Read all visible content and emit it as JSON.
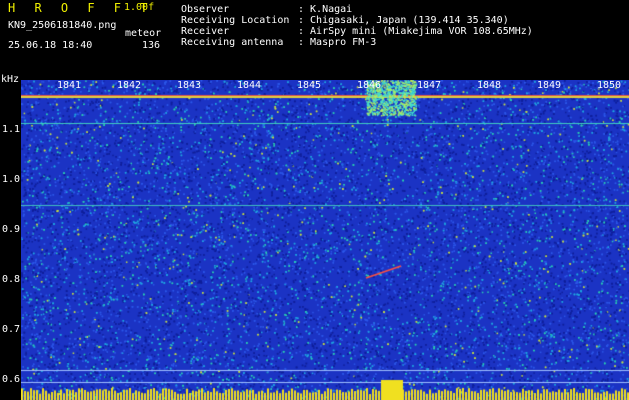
{
  "header": {
    "title": "H R O F F T",
    "version": "1.00f",
    "file": "KN9_2506181840.png",
    "mode": "meteor",
    "datetime": "25.06.18 18:40",
    "count": "136"
  },
  "meta": [
    {
      "label": "Observer",
      "value": ": K.Nagai"
    },
    {
      "label": "Receiving Location",
      "value": ": Chigasaki, Japan (139.414 35.340)"
    },
    {
      "label": "Receiver",
      "value": ": AirSpy mini (Miakejima VOR 108.65MHz)"
    },
    {
      "label": "Receiving antenna",
      "value": ": Maspro FM-3"
    }
  ],
  "axes": {
    "y_unit": "kHz",
    "x_ticks": [
      "1841",
      "1842",
      "1843",
      "1844",
      "1845",
      "1846",
      "1847",
      "1848",
      "1849",
      "1850"
    ],
    "y_ticks": [
      "1.1",
      "1.0",
      "0.9",
      "0.8",
      "0.7",
      "0.6"
    ]
  },
  "colors": {
    "background": "#000000",
    "plot": "#1b33c4",
    "accent": "#f0f000"
  }
}
